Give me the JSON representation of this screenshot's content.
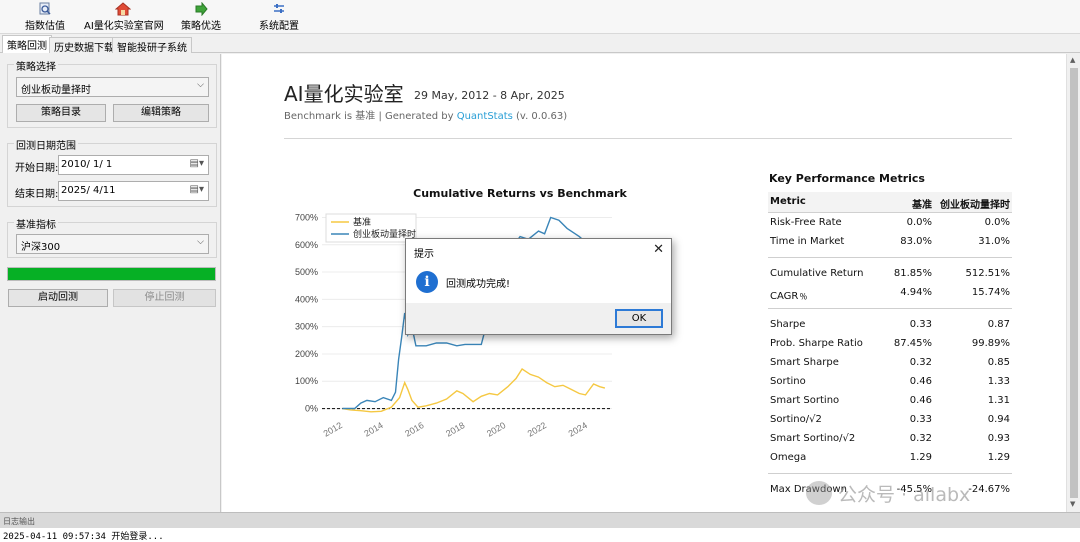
{
  "toolbar": {
    "items": [
      {
        "label": "指数估值",
        "icon": "magnifier-chart-icon"
      },
      {
        "label": "AI量化实验室官网",
        "icon": "home-icon"
      },
      {
        "label": "策略优选",
        "icon": "green-arrow-icon"
      },
      {
        "label": "系统配置",
        "icon": "sliders-icon"
      }
    ]
  },
  "tabs": [
    "策略回测",
    "历史数据下载",
    "智能投研子系统"
  ],
  "left": {
    "strategy_group": "策略选择",
    "strategy_value": "创业板动量择时",
    "btn_catalog": "策略目录",
    "btn_edit": "编辑策略",
    "date_group": "回测日期范围",
    "start_label": "开始日期:",
    "start_value": "2010/  1/  1",
    "end_label": "结束日期:",
    "end_value": "2025/  4/11",
    "benchmark_group": "基准指标",
    "benchmark_value": "沪深300",
    "progress": 1.0,
    "btn_start": "启动回测",
    "btn_stop": "停止回测"
  },
  "report": {
    "title": "AI量化实验室",
    "dates": "29 May, 2012 - 8 Apr, 2025",
    "sub_prefix": "Benchmark is 基准 | Generated by ",
    "sub_link": "QuantStats",
    "sub_suffix": " (v. 0.0.63)",
    "kpm_title": "Key Performance Metrics",
    "metrics_header": [
      "Metric",
      "基准",
      "创业板动量择时"
    ],
    "metrics": [
      [
        "Risk-Free Rate",
        "0.0%",
        "0.0%"
      ],
      [
        "Time in Market",
        "83.0%",
        "31.0%"
      ],
      null,
      [
        "Cumulative Return",
        "81.85%",
        "512.51%"
      ],
      [
        "CAGR﹪",
        "4.94%",
        "15.74%"
      ],
      null,
      [
        "Sharpe",
        "0.33",
        "0.87"
      ],
      [
        "Prob. Sharpe Ratio",
        "87.45%",
        "99.89%"
      ],
      [
        "Smart Sharpe",
        "0.32",
        "0.85"
      ],
      [
        "Sortino",
        "0.46",
        "1.33"
      ],
      [
        "Smart Sortino",
        "0.46",
        "1.31"
      ],
      [
        "Sortino/√2",
        "0.33",
        "0.94"
      ],
      [
        "Smart Sortino/√2",
        "0.32",
        "0.93"
      ],
      [
        "Omega",
        "1.29",
        "1.29"
      ],
      null,
      [
        "Max Drawdown",
        "-45.5%",
        "-24.67%"
      ]
    ]
  },
  "chart_data": {
    "type": "line",
    "title": "Cumulative Returns vs Benchmark",
    "x_ticks": [
      "2012",
      "2014",
      "2016",
      "2018",
      "2020",
      "2022",
      "2024"
    ],
    "y_ticks": [
      "0%",
      "100%",
      "200%",
      "300%",
      "400%",
      "500%",
      "600%",
      "700%"
    ],
    "ylim": [
      -20,
      720
    ],
    "xlim": [
      2011.4,
      2025.6
    ],
    "legend_position": "top-left",
    "series": [
      {
        "name": "基准",
        "color": "#f5c842",
        "points": [
          [
            2012.4,
            0
          ],
          [
            2012.8,
            -5
          ],
          [
            2013.3,
            -8
          ],
          [
            2013.8,
            -12
          ],
          [
            2014.3,
            -10
          ],
          [
            2014.8,
            5
          ],
          [
            2015.2,
            40
          ],
          [
            2015.45,
            95
          ],
          [
            2015.6,
            70
          ],
          [
            2015.8,
            30
          ],
          [
            2016.1,
            5
          ],
          [
            2016.5,
            10
          ],
          [
            2017.0,
            20
          ],
          [
            2017.5,
            35
          ],
          [
            2018.0,
            65
          ],
          [
            2018.3,
            55
          ],
          [
            2018.8,
            25
          ],
          [
            2019.2,
            45
          ],
          [
            2019.6,
            55
          ],
          [
            2020.0,
            50
          ],
          [
            2020.5,
            80
          ],
          [
            2020.9,
            110
          ],
          [
            2021.2,
            145
          ],
          [
            2021.6,
            125
          ],
          [
            2022.0,
            115
          ],
          [
            2022.4,
            95
          ],
          [
            2022.8,
            80
          ],
          [
            2023.2,
            85
          ],
          [
            2023.6,
            70
          ],
          [
            2024.0,
            55
          ],
          [
            2024.3,
            50
          ],
          [
            2024.7,
            90
          ],
          [
            2025.0,
            80
          ],
          [
            2025.25,
            75
          ]
        ]
      },
      {
        "name": "创业板动量择时",
        "color": "#3a85b8",
        "points": [
          [
            2012.4,
            0
          ],
          [
            2013.0,
            0
          ],
          [
            2013.3,
            20
          ],
          [
            2013.6,
            30
          ],
          [
            2014.0,
            25
          ],
          [
            2014.4,
            40
          ],
          [
            2014.8,
            30
          ],
          [
            2015.0,
            60
          ],
          [
            2015.15,
            180
          ],
          [
            2015.3,
            260
          ],
          [
            2015.45,
            350
          ],
          [
            2015.6,
            270
          ],
          [
            2015.8,
            300
          ],
          [
            2016.0,
            230
          ],
          [
            2016.5,
            230
          ],
          [
            2017.0,
            240
          ],
          [
            2017.5,
            240
          ],
          [
            2018.0,
            230
          ],
          [
            2018.4,
            235
          ],
          [
            2018.8,
            235
          ],
          [
            2019.2,
            235
          ],
          [
            2019.6,
            350
          ],
          [
            2020.0,
            410
          ],
          [
            2020.5,
            520
          ],
          [
            2020.8,
            600
          ],
          [
            2021.1,
            630
          ],
          [
            2021.5,
            620
          ],
          [
            2022.0,
            650
          ],
          [
            2022.3,
            640
          ],
          [
            2022.6,
            700
          ],
          [
            2023.0,
            690
          ],
          [
            2023.4,
            660
          ],
          [
            2023.8,
            640
          ],
          [
            2024.0,
            630
          ],
          [
            2024.3,
            610
          ],
          [
            2024.6,
            600
          ],
          [
            2024.8,
            540
          ],
          [
            2025.0,
            560
          ],
          [
            2025.25,
            510
          ]
        ]
      }
    ]
  },
  "dialog": {
    "title": "提示",
    "message": "回测成功完成!",
    "ok": "OK"
  },
  "log": {
    "header": "日志输出",
    "line": "2025-04-11 09:57:34 开始登录..."
  },
  "watermark": "公众号 · ailabx"
}
